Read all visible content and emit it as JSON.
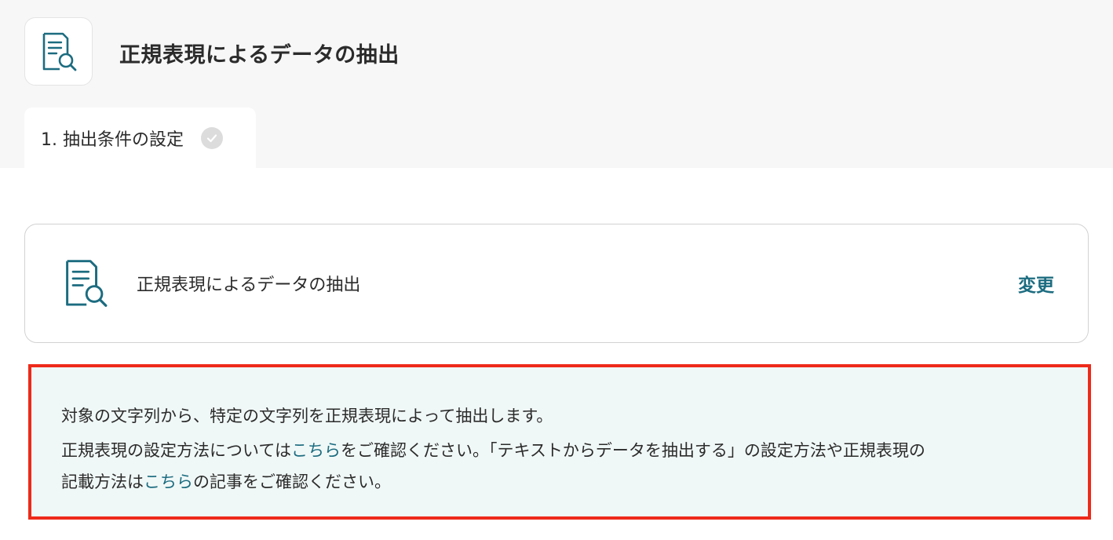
{
  "app": {
    "title": "正規表現によるデータの抽出",
    "icon": "document-search-icon"
  },
  "tabs": [
    {
      "label": "1. 抽出条件の設定",
      "status_icon": "check-circle-icon",
      "completed": true
    }
  ],
  "action_card": {
    "name": "正規表現によるデータの抽出",
    "icon": "document-search-icon",
    "change_label": "変更"
  },
  "info": {
    "line1": "対象の文字列から、特定の文字列を正規表現によって抽出します。",
    "line2_before": "正規表現の設定方法については",
    "line2_link": "こちら",
    "line2_after": "をご確認ください。「テキストからデータを抽出する」の設定方法や正規表現の",
    "line3_before": "記載方法は",
    "line3_link": "こちら",
    "line3_after": "の記事をご確認ください。"
  },
  "colors": {
    "accent": "#1c6c80",
    "highlight_border": "#ee2a1a",
    "info_bg": "#f0f8f7"
  }
}
